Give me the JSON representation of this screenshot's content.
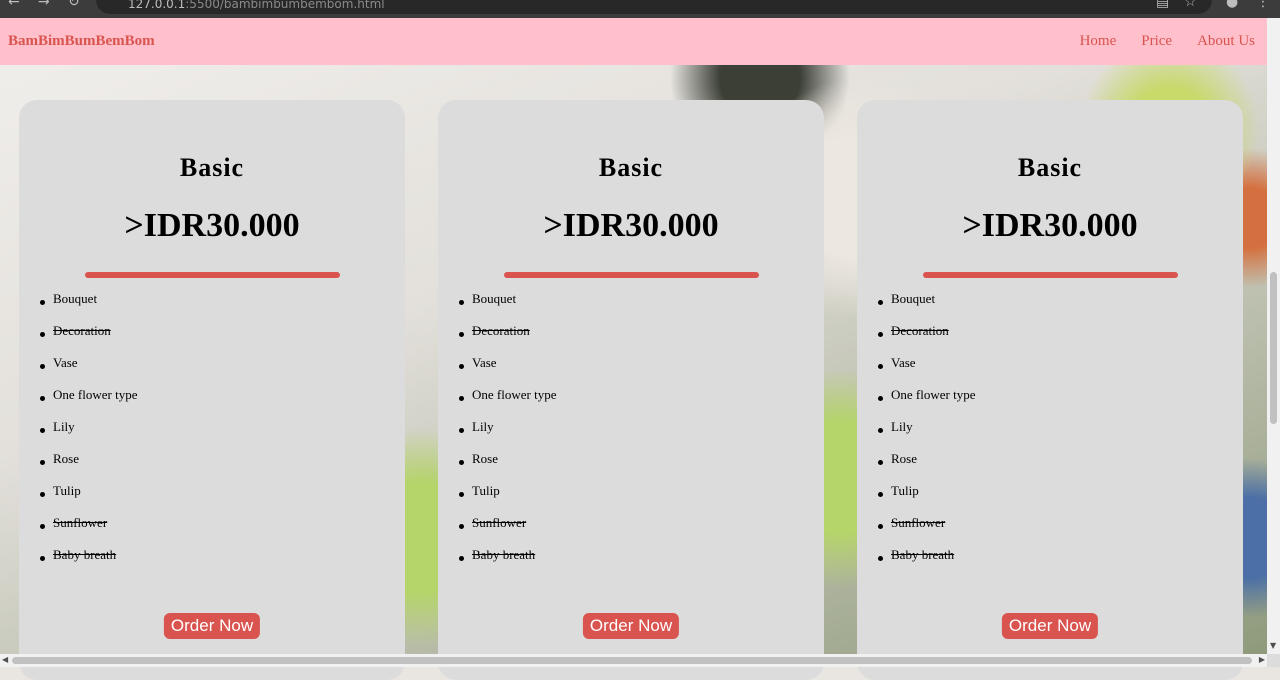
{
  "browser": {
    "url_host": "127.0.0.1",
    "url_path": ":5500/bambimbumbembom.html"
  },
  "navbar": {
    "brand": "BamBimBumBemBom",
    "links": [
      "Home",
      "Price",
      "About Us"
    ]
  },
  "cards": [
    {
      "title": "Basic",
      "price": ">IDR30.000",
      "features": [
        {
          "label": "Bouquet",
          "included": true
        },
        {
          "label": "Decoration",
          "included": false
        },
        {
          "label": "Vase",
          "included": true
        },
        {
          "label": "One flower type",
          "included": true
        },
        {
          "label": "Lily",
          "included": true
        },
        {
          "label": "Rose",
          "included": true
        },
        {
          "label": "Tulip",
          "included": true
        },
        {
          "label": "Sunflower",
          "included": false
        },
        {
          "label": "Baby breath",
          "included": false
        }
      ],
      "button": "Order Now"
    },
    {
      "title": "Basic",
      "price": ">IDR30.000",
      "features": [
        {
          "label": "Bouquet",
          "included": true
        },
        {
          "label": "Decoration",
          "included": false
        },
        {
          "label": "Vase",
          "included": true
        },
        {
          "label": "One flower type",
          "included": true
        },
        {
          "label": "Lily",
          "included": true
        },
        {
          "label": "Rose",
          "included": true
        },
        {
          "label": "Tulip",
          "included": true
        },
        {
          "label": "Sunflower",
          "included": false
        },
        {
          "label": "Baby breath",
          "included": false
        }
      ],
      "button": "Order Now"
    },
    {
      "title": "Basic",
      "price": ">IDR30.000",
      "features": [
        {
          "label": "Bouquet",
          "included": true
        },
        {
          "label": "Decoration",
          "included": false
        },
        {
          "label": "Vase",
          "included": true
        },
        {
          "label": "One flower type",
          "included": true
        },
        {
          "label": "Lily",
          "included": true
        },
        {
          "label": "Rose",
          "included": true
        },
        {
          "label": "Tulip",
          "included": true
        },
        {
          "label": "Sunflower",
          "included": false
        },
        {
          "label": "Baby breath",
          "included": false
        }
      ],
      "button": "Order Now"
    }
  ],
  "colors": {
    "navbar_bg": "#ffc0cb",
    "accent": "#d9534f",
    "card_bg": "#dcdcdc"
  }
}
